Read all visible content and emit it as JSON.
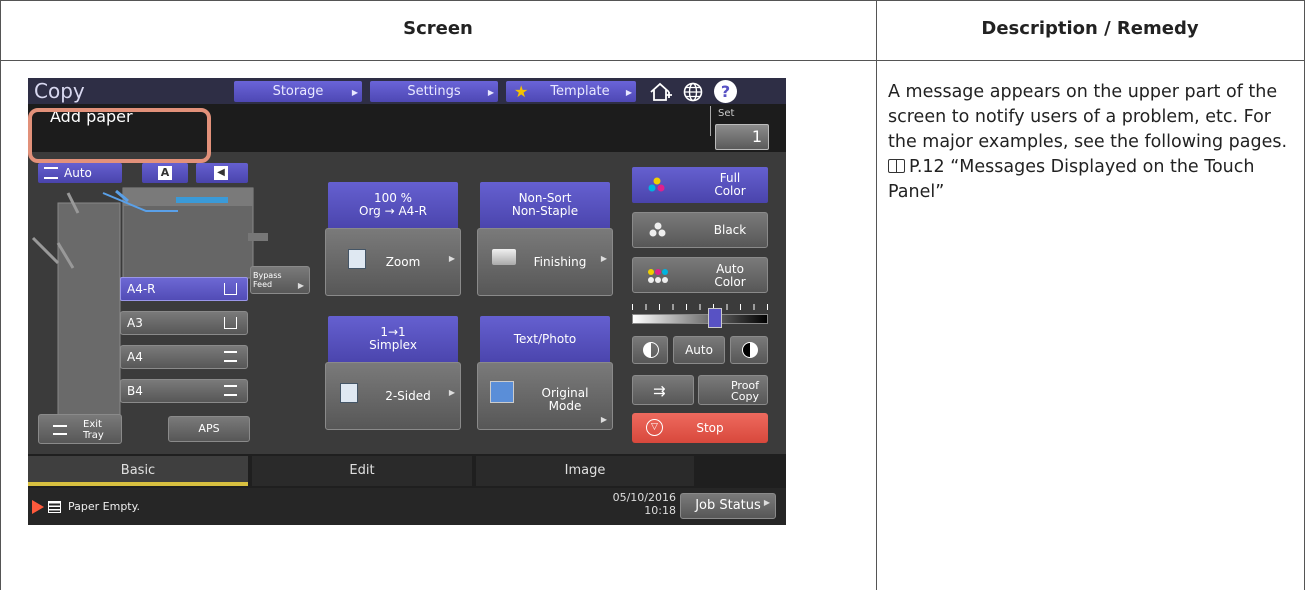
{
  "table": {
    "col1_header": "Screen",
    "col2_header": "Description / Remedy"
  },
  "description": {
    "para1": "A message appears on the upper part of the screen to notify users of a problem, etc. For the major examples, see the following pages.",
    "ref": "P.12 “Messages Displayed on the Touch Panel”"
  },
  "panel": {
    "title": "Copy",
    "top_buttons": [
      "Storage",
      "Settings",
      "Template"
    ],
    "message": "Add paper",
    "set_label": "Set",
    "set_value": "1",
    "auto_label": "Auto",
    "bypass_label": "Bypass Feed",
    "trays": [
      "A4-R",
      "A3",
      "A4",
      "B4"
    ],
    "exit_tray_label": "Exit Tray",
    "aps_label": "APS",
    "zoom_info": [
      "100 %",
      "Org → A4-R"
    ],
    "zoom_label": "Zoom",
    "finishing_info": [
      "Non-Sort",
      "Non-Staple"
    ],
    "finishing_label": "Finishing",
    "duplex_info": [
      "1→1",
      "Simplex"
    ],
    "duplex_label": "2-Sided",
    "mode_info": "Text/Photo",
    "mode_label": [
      "Original",
      "Mode"
    ],
    "color_buttons": [
      [
        "Full",
        "Color"
      ],
      [
        "Black"
      ],
      [
        "Auto",
        "Color"
      ]
    ],
    "density_auto": "Auto",
    "proof_label": [
      "Proof",
      "Copy"
    ],
    "stop_label": "Stop",
    "tabs": [
      "Basic",
      "Edit",
      "Image"
    ],
    "status_text": "Paper Empty.",
    "date": "05/10/2016",
    "time": "10:18",
    "job_status": "Job Status"
  },
  "colors": {
    "highlight": "#e2917a",
    "accent_blue": "#5852c4",
    "stop_red": "#e0584c",
    "tab_underline": "#d8c040"
  }
}
